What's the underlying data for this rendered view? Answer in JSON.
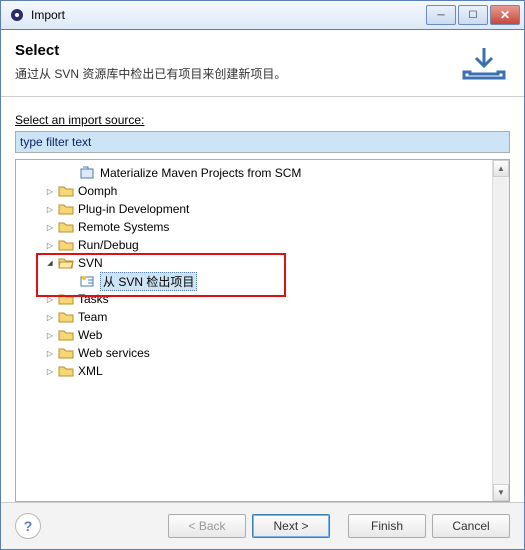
{
  "window": {
    "title": "Import"
  },
  "header": {
    "title": "Select",
    "desc": "通过从 SVN 资源库中检出已有项目来创建新项目。"
  },
  "body": {
    "label": "Select an import source:",
    "filter_value": "type filter text"
  },
  "tree": {
    "n0": "Materialize Maven Projects from SCM",
    "n1": "Oomph",
    "n2": "Plug-in Development",
    "n3": "Remote Systems",
    "n4": "Run/Debug",
    "n5": "SVN",
    "n5a": "从 SVN 检出项目",
    "n6": "Tasks",
    "n7": "Team",
    "n8": "Web",
    "n9": "Web services",
    "n10": "XML"
  },
  "buttons": {
    "back": "< Back",
    "next": "Next >",
    "finish": "Finish",
    "cancel": "Cancel"
  }
}
